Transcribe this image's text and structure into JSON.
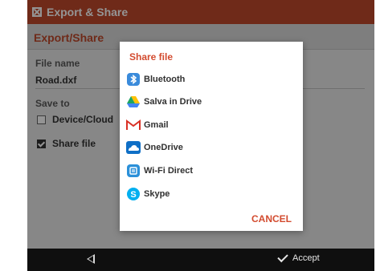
{
  "app": {
    "title": "Export & Share"
  },
  "section": {
    "title": "Export/Share"
  },
  "form": {
    "file_name_label": "File name",
    "file_name_value": "Road.dxf",
    "save_to_label": "Save to",
    "device_cloud_label": "Device/Cloud",
    "share_file_label": "Share file"
  },
  "dialog": {
    "title": "Share file",
    "options": [
      {
        "label": "Bluetooth",
        "icon": "bluetooth-icon",
        "color": "#3a8bdb"
      },
      {
        "label": "Salva in Drive",
        "icon": "google-drive-icon",
        "color": "#1da462"
      },
      {
        "label": "Gmail",
        "icon": "gmail-icon",
        "color": "#d93025"
      },
      {
        "label": "OneDrive",
        "icon": "onedrive-icon",
        "color": "#0f6fc6"
      },
      {
        "label": "Wi-Fi Direct",
        "icon": "wifi-direct-icon",
        "color": "#2b90d9"
      },
      {
        "label": "Skype",
        "icon": "skype-icon",
        "color": "#00aff0"
      }
    ],
    "cancel_label": "CANCEL"
  },
  "navbar": {
    "accept_label": "Accept"
  },
  "colors": {
    "accent": "#c0492b"
  }
}
